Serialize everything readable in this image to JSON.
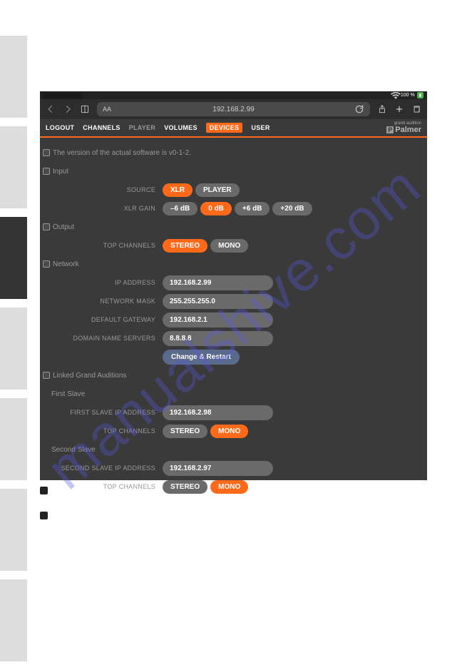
{
  "watermark": "manualshive.com",
  "status": {
    "battery_pct": "100 %",
    "wifi_icon": "wifi"
  },
  "address_bar": {
    "url": "192.168.2.99",
    "aA": "AA"
  },
  "nav": {
    "items": [
      "LOGOUT",
      "CHANNELS",
      "PLAYER",
      "VOLUMES",
      "DEVICES",
      "USER"
    ],
    "active_index": 4
  },
  "logo": {
    "sub": "grand audition",
    "main": "Palmer"
  },
  "version_text": "The version of the actual software is v0-1-2.",
  "sections": {
    "input": {
      "label": "Input",
      "source_label": "SOURCE",
      "source_opts": [
        "XLR",
        "PLAYER"
      ],
      "source_active": 0,
      "gain_label": "XLR GAIN",
      "gain_opts": [
        "–6 dB",
        "0 dB",
        "+6 dB",
        "+20 dB"
      ],
      "gain_active": 1
    },
    "output": {
      "label": "Output",
      "top_label": "TOP CHANNELS",
      "top_opts": [
        "STEREO",
        "MONO"
      ],
      "top_active": 0
    },
    "network": {
      "label": "Network",
      "ip_label": "IP ADDRESS",
      "ip": "192.168.2.99",
      "mask_label": "NETWORK MASK",
      "mask": "255.255.255.0",
      "gw_label": "DEFAULT GATEWAY",
      "gw": "192.168.2.1",
      "dns_label": "DOMAIN NAME SERVERS",
      "dns": "8.8.8.8",
      "action": "Change & Restart"
    },
    "linked": {
      "label": "Linked Grand Auditions",
      "first_label": "First Slave",
      "first_ip_label": "FIRST SLAVE IP ADDRESS",
      "first_ip": "192.168.2.98",
      "first_top_label": "TOP CHANNELS",
      "first_top_opts": [
        "STEREO",
        "MONO"
      ],
      "first_top_active": 1,
      "second_label": "Second Slave",
      "second_ip_label": "SECOND SLAVE IP ADDRESS",
      "second_ip": "192.168.2.97",
      "second_top_label": "TOP CHANNELS",
      "second_top_opts": [
        "STEREO",
        "MONO"
      ],
      "second_top_active": 1
    }
  }
}
